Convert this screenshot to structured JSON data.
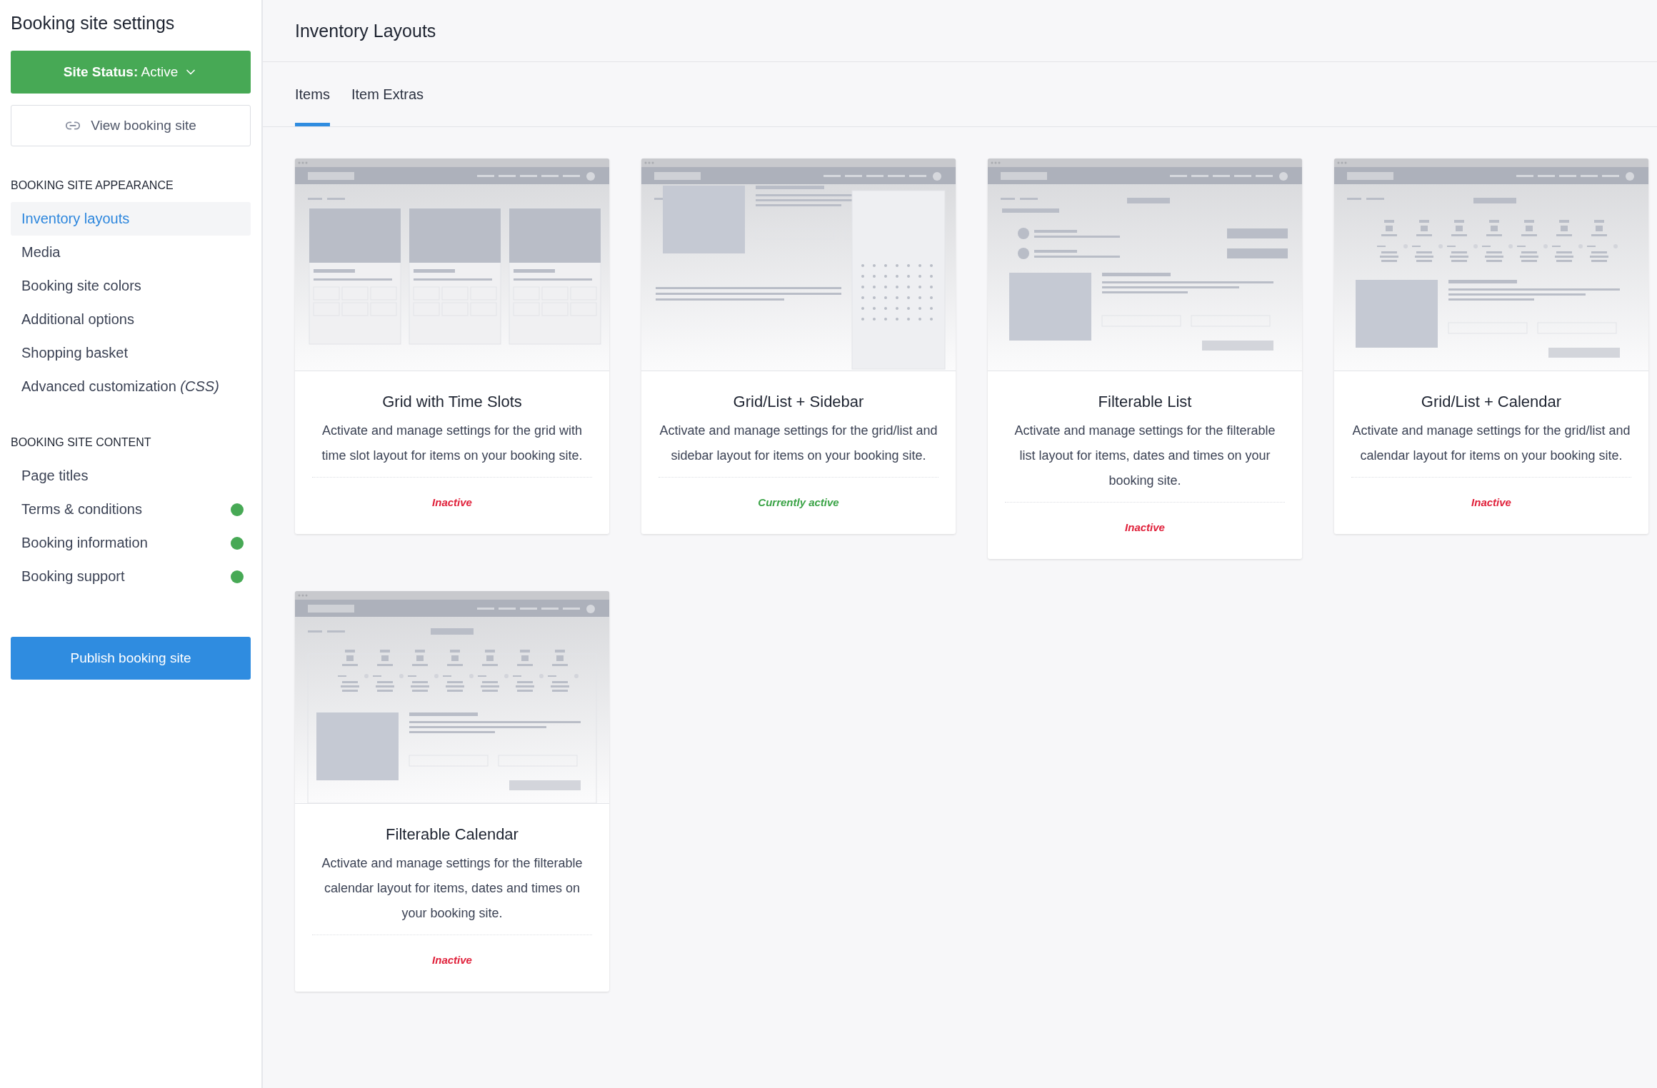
{
  "sidebar": {
    "title": "Booking site settings",
    "status_button": {
      "label": "**Site Status:** Active"
    },
    "view_button": {
      "label": "View booking site"
    },
    "sections": [
      {
        "heading": "BOOKING SITE APPEARANCE",
        "items": [
          {
            "label": "Inventory layouts",
            "selected": true,
            "done": false
          },
          {
            "label": "Media",
            "selected": false,
            "done": false
          },
          {
            "label": "Booking site colors",
            "selected": false,
            "done": false
          },
          {
            "label": "Additional options",
            "selected": false,
            "done": false
          },
          {
            "label": "Shopping basket",
            "selected": false,
            "done": false
          },
          {
            "label": "Advanced customization *(CSS)*",
            "selected": false,
            "done": false
          }
        ]
      },
      {
        "heading": "BOOKING SITE CONTENT",
        "items": [
          {
            "label": "Page titles",
            "selected": false,
            "done": false
          },
          {
            "label": "Terms & conditions",
            "selected": false,
            "done": true
          },
          {
            "label": "Booking information",
            "selected": false,
            "done": true
          },
          {
            "label": "Booking support",
            "selected": false,
            "done": true
          }
        ]
      }
    ],
    "publish_button": {
      "label": "Publish booking site"
    }
  },
  "main": {
    "title": "Inventory Layouts",
    "tabs": [
      {
        "label": "Items",
        "selected": true
      },
      {
        "label": "Item Extras",
        "selected": false
      }
    ],
    "layouts": [
      {
        "kind": "grid",
        "title": "Grid with Time Slots",
        "description": "Activate and manage settings for the grid with time slot layout for items on your booking site.",
        "status": "Inactive",
        "active": false
      },
      {
        "kind": "sidebar",
        "title": "Grid/List + Sidebar",
        "description": "Activate and manage settings for the grid/list and sidebar layout for items on your booking site.",
        "status": "Currently active",
        "active": true
      },
      {
        "kind": "list",
        "title": "Filterable List",
        "description": "Activate and manage settings for the filterable list layout for items, dates and times on your booking site.",
        "status": "Inactive",
        "active": false
      },
      {
        "kind": "calendar",
        "title": "Grid/List + Calendar",
        "description": "Activate and manage settings for the grid/list and calendar layout for items on your booking site.",
        "status": "Inactive",
        "active": false
      },
      {
        "kind": "filtercal",
        "title": "Filterable Calendar",
        "description": "Activate and manage settings for the filterable calendar layout for items, dates and times on your booking site.",
        "status": "Inactive",
        "active": false
      }
    ]
  }
}
